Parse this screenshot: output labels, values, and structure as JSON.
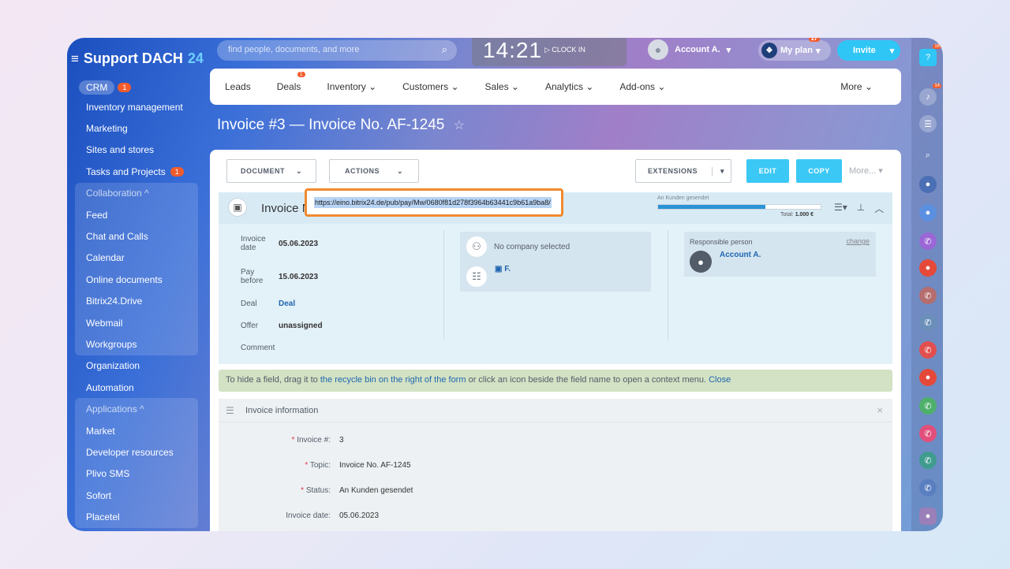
{
  "app": {
    "name": "Support DACH",
    "name_num": "24"
  },
  "search": {
    "placeholder": "find people, documents, and more"
  },
  "clock": {
    "time": "14:21",
    "action": "CLOCK IN"
  },
  "account": {
    "name": "Account A."
  },
  "plan": {
    "label": "My plan",
    "badge": "27"
  },
  "invite": {
    "label": "Invite"
  },
  "sidebar": {
    "crm": {
      "label": "CRM",
      "badge": "1"
    },
    "items_a": [
      {
        "label": "Inventory management"
      },
      {
        "label": "Marketing"
      },
      {
        "label": "Sites and stores"
      },
      {
        "label": "Tasks and Projects",
        "badge": "1"
      }
    ],
    "collab_head": "Collaboration ^",
    "collab_items": [
      {
        "label": "Feed"
      },
      {
        "label": "Chat and Calls"
      },
      {
        "label": "Calendar"
      },
      {
        "label": "Online documents"
      },
      {
        "label": "Bitrix24.Drive"
      },
      {
        "label": "Webmail"
      },
      {
        "label": "Workgroups"
      }
    ],
    "items_b": [
      {
        "label": "Organization"
      },
      {
        "label": "Automation"
      }
    ],
    "apps_head": "Applications ^",
    "apps_items": [
      {
        "label": "Market"
      },
      {
        "label": "Developer resources"
      },
      {
        "label": "Plivo SMS"
      },
      {
        "label": "Sofort"
      },
      {
        "label": "Placetel"
      }
    ]
  },
  "rightbar": {
    "help_badge": "16",
    "notif_badge": "14"
  },
  "tabs": [
    {
      "label": "Leads"
    },
    {
      "label": "Deals",
      "badge": "1"
    },
    {
      "label": "Inventory ⌄"
    },
    {
      "label": "Customers ⌄"
    },
    {
      "label": "Sales ⌄"
    },
    {
      "label": "Analytics ⌄"
    },
    {
      "label": "Add-ons ⌄"
    }
  ],
  "tabs_more": "More ⌄",
  "page": {
    "title": "Invoice #3 — Invoice No. AF-1245",
    "star": "☆"
  },
  "toolbar": {
    "document": "DOCUMENT",
    "actions": "ACTIONS",
    "extensions": "EXTENSIONS",
    "edit": "EDIT",
    "copy": "COPY",
    "more": "More... ▾"
  },
  "entity": {
    "title": "Invoice N",
    "status_label": "An Kunden gesendet",
    "status_progress": 0.66,
    "total_label": "Total:",
    "total_value": "1.000 €"
  },
  "url_popup": {
    "url": "https://eino.bitrix24.de/pub/pay/Mw/0680f81d278f3964b63441c9b61a9ba8/"
  },
  "fields": {
    "invoice_date_label": "Invoice date",
    "invoice_date": "05.06.2023",
    "pay_before_label": "Pay before",
    "pay_before": "15.06.2023",
    "deal_label": "Deal",
    "deal": "Deal",
    "offer_label": "Offer",
    "offer": "unassigned",
    "comment_label": "Comment",
    "company": "No company selected",
    "contact": "F.",
    "responsible_label": "Responsible person",
    "responsible_change": "change",
    "responsible": "Account A."
  },
  "hint": {
    "text1": "To hide a field, drag it to ",
    "link": "the recycle bin on the right of the form",
    "text2": " or click an icon beside the field name to open a context menu. ",
    "close": "Close"
  },
  "section": {
    "title": "Invoice information",
    "rows": [
      {
        "label": "Invoice #:",
        "value": "3",
        "required": "*"
      },
      {
        "label": "Topic:",
        "value": "Invoice No. AF-1245",
        "required": "*"
      },
      {
        "label": "Status:",
        "value": "An Kunden gesendet",
        "required": "*"
      },
      {
        "label": "Invoice date:",
        "value": "05.06.2023",
        "required": ""
      }
    ]
  }
}
